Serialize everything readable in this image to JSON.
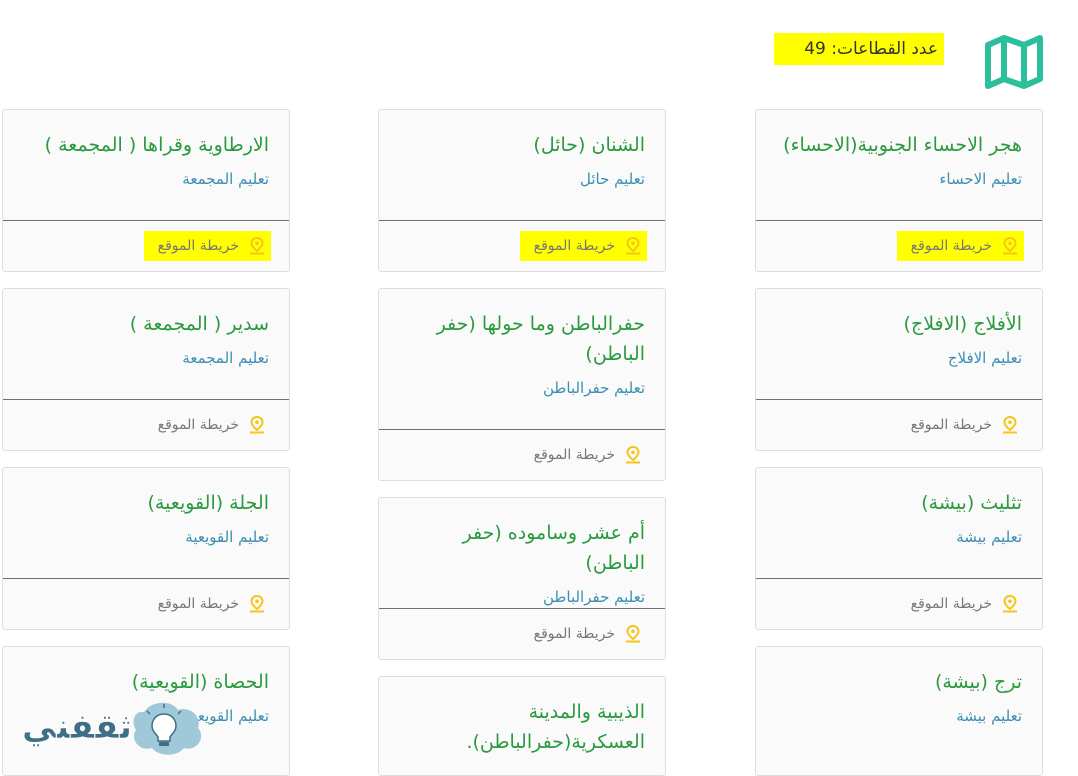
{
  "header": {
    "count_text": "عدد القطاعات: 49",
    "logo_icon": "folded-map-icon"
  },
  "map_link_label": "خريطة الموقع",
  "pin_icon": "map-pin-icon",
  "cards": {
    "c1": {
      "title": "هجر الاحساء الجنوبية(الاحساء)",
      "sub": "تعليم الاحساء"
    },
    "c2": {
      "title": "الشنان (حائل)",
      "sub": "تعليم حائل"
    },
    "c3": {
      "title": "الارطاوية وقراها ( المجمعة )",
      "sub": "تعليم المجمعة"
    },
    "c4": {
      "title": "الأفلاج (الافلاج)",
      "sub": "تعليم الافلاج"
    },
    "c5": {
      "title": "حفرالباطن وما حولها (حفر الباطن)",
      "sub": "تعليم حفرالباطن"
    },
    "c6": {
      "title": "سدير ( المجمعة )",
      "sub": "تعليم المجمعة"
    },
    "c7": {
      "title": "تثليث (بيشة)",
      "sub": "تعليم بيشة"
    },
    "c8": {
      "title": "أم عشر وساموده (حفر الباطن)",
      "sub": "تعليم حفرالباطن"
    },
    "c9": {
      "title": "الجلة (القويعية)",
      "sub": "تعليم القويعية"
    },
    "c10": {
      "title": "ترج (بيشة)",
      "sub": "تعليم بيشة"
    },
    "c11": {
      "title": "الذيبية والمدينة العسكرية(حفرالباطن).",
      "sub": ""
    },
    "c12": {
      "title": "الحصاة (القويعية)",
      "sub": "تعليم القويعية"
    }
  },
  "watermark": {
    "text": "ثقفني",
    "icon": "lightbulb-icon"
  },
  "colors": {
    "highlight": "#ffff00",
    "title_green": "#2a9a3f",
    "subtitle_blue": "#3a8fb2",
    "logo_teal": "#2bbf9b",
    "pin_yellow": "#f5c518"
  }
}
